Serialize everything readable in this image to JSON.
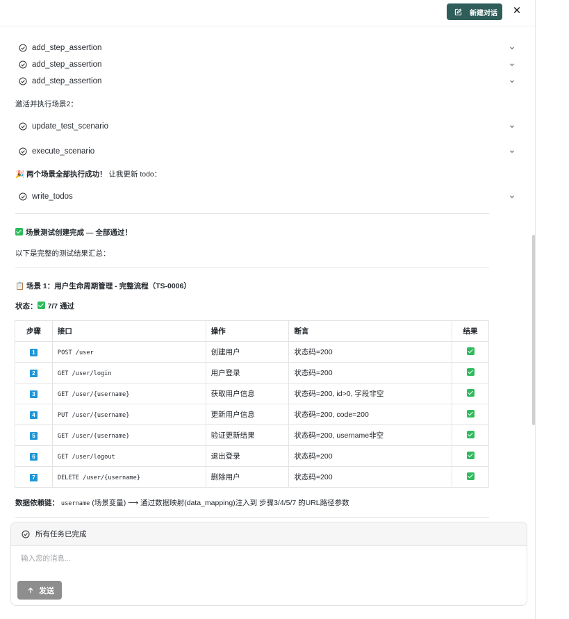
{
  "header": {
    "new_chat_label": "新建对话",
    "close_glyph": "✕"
  },
  "tools": {
    "assert1": "add_step_assertion",
    "assert2": "add_step_assertion",
    "assert3": "add_step_assertion",
    "update": "update_test_scenario",
    "execute": "execute_scenario",
    "todos": "write_todos"
  },
  "messages": {
    "activate": "激活并执行场景2：",
    "success_emoji": "🎉",
    "success_bold": "两个场景全部执行成功！",
    "success_rest": "让我更新 todo：",
    "complete_title": "场景测试创建完成 — 全部通过！",
    "summary_intro": "以下是完整的测试结果汇总：",
    "scenario_emoji": "📋",
    "scenario_title": "场景 1：用户生命周期管理 - 完整流程（TS-0006）",
    "status_label": "状态：",
    "status_value": "7/7 通过",
    "dep_label": "数据依赖链：",
    "dep_code": "username",
    "dep_text": "(场景变量) ⟶ 通过数据映射(data_mapping)注入到 步骤3/4/5/7 的URL路径参数"
  },
  "table": {
    "headers": {
      "step": "步骤",
      "api": "接口",
      "op": "操作",
      "assert": "断言",
      "result": "结果"
    },
    "rows": [
      {
        "n": "1",
        "api": "POST /user",
        "op": "创建用户",
        "assert": "状态码=200",
        "passed": true
      },
      {
        "n": "2",
        "api": "GET /user/login",
        "op": "用户登录",
        "assert": "状态码=200",
        "passed": true
      },
      {
        "n": "3",
        "api": "GET /user/{username}",
        "op": "获取用户信息",
        "assert": "状态码=200, id>0, 字段非空",
        "passed": true
      },
      {
        "n": "4",
        "api": "PUT /user/{username}",
        "op": "更新用户信息",
        "assert": "状态码=200, code=200",
        "passed": true
      },
      {
        "n": "5",
        "api": "GET /user/{username}",
        "op": "验证更新结果",
        "assert": "状态码=200, username非空",
        "passed": true
      },
      {
        "n": "6",
        "api": "GET /user/logout",
        "op": "退出登录",
        "assert": "状态码=200",
        "passed": true
      },
      {
        "n": "7",
        "api": "DELETE /user/{username}",
        "op": "删除用户",
        "assert": "状态码=200",
        "passed": true
      }
    ]
  },
  "composer": {
    "status_text": "所有任务已完成",
    "placeholder": "输入您的消息...",
    "send_label": "发送"
  },
  "colors": {
    "brand": "#2f5d5a",
    "success": "#2dbb5d",
    "step_badge": "#1e96d8",
    "send_disabled": "#8e8e8e"
  }
}
